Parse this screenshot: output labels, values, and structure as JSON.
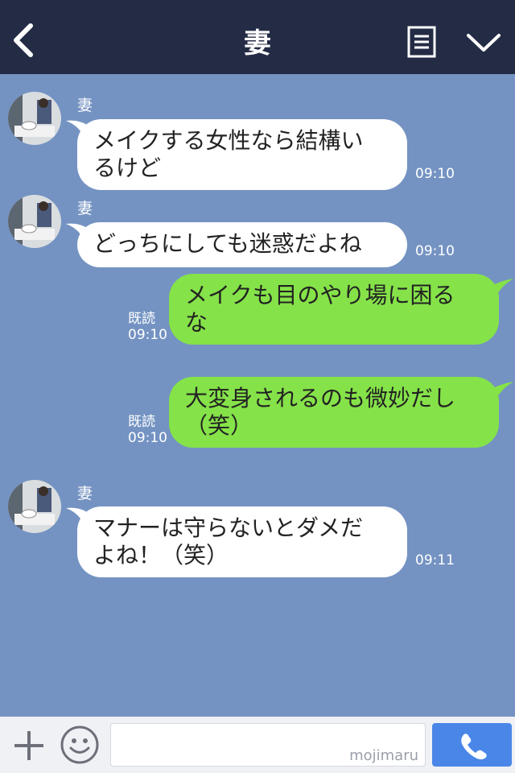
{
  "header": {
    "title": "妻"
  },
  "messages": [
    {
      "sender": "妻",
      "lines": [
        "メイクする女性なら結構い",
        "るけど"
      ],
      "time": "09:10"
    },
    {
      "sender": "妻",
      "lines": [
        "どっちにしても迷惑だよね"
      ],
      "time": "09:10"
    },
    {
      "read": "既読",
      "lines": [
        "メイクも目のやり場に困る",
        "な"
      ],
      "time": "09:10"
    },
    {
      "read": "既読",
      "lines": [
        "大変身されるのも微妙だし",
        "（笑）"
      ],
      "time": "09:10"
    },
    {
      "sender": "妻",
      "lines": [
        "マナーは守らないとダメだ",
        "よね！（笑）"
      ],
      "time": "09:11"
    }
  ],
  "footer": {
    "watermark": "mojimaru"
  },
  "colors": {
    "header": "#242b45",
    "background": "#7493c2",
    "outgoing": "#85e249",
    "incoming": "#ffffff",
    "send": "#4a86e8"
  },
  "icons": [
    "back-arrow-icon",
    "notes-icon",
    "chevron-down-icon",
    "plus-icon",
    "smiley-icon",
    "phone-icon"
  ]
}
